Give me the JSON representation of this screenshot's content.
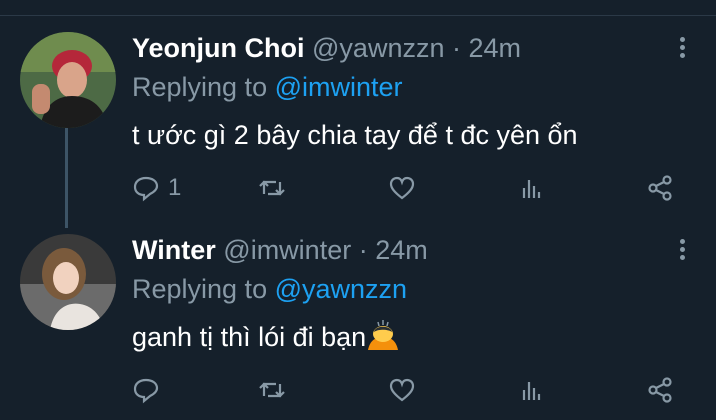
{
  "tweets": [
    {
      "name": "Yeonjun Choi",
      "handle": "@yawnzzn",
      "separator": " · ",
      "time": "24m",
      "replying_prefix": "Replying to ",
      "replying_to": "@imwinter",
      "text": "t ước gì 2 bây chia tay để t đc yên ổn",
      "reply_count": "1"
    },
    {
      "name": "Winter",
      "handle": "@imwinter",
      "separator": " · ",
      "time": "24m",
      "replying_prefix": "Replying to ",
      "replying_to": "@yawnzzn",
      "text": "ganh tị thì lói đi bạn",
      "emoji": "person-bowing",
      "reply_count": ""
    }
  ],
  "colors": {
    "background": "#15202b",
    "secondary_text": "#8899a6",
    "link": "#1da1f2",
    "thread_line": "#3d5466"
  },
  "icons": [
    "more-icon",
    "reply-icon",
    "retweet-icon",
    "like-icon",
    "analytics-icon",
    "share-icon"
  ]
}
